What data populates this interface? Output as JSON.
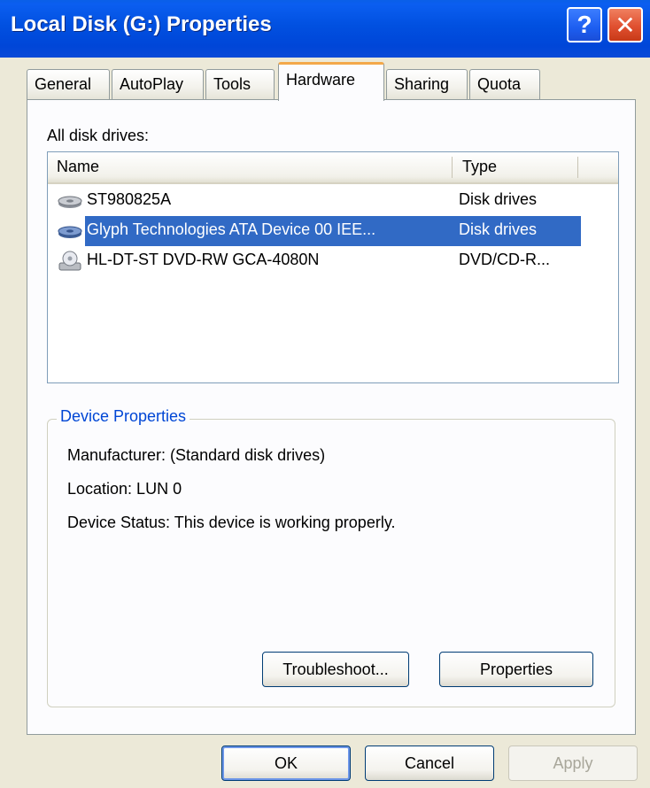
{
  "window": {
    "title": "Local Disk (G:) Properties",
    "help_glyph": "?",
    "close_glyph": "✕"
  },
  "tabs": [
    {
      "label": "General"
    },
    {
      "label": "AutoPlay"
    },
    {
      "label": "Tools"
    },
    {
      "label": "Hardware",
      "active": true
    },
    {
      "label": "Sharing"
    },
    {
      "label": "Quota"
    }
  ],
  "hardware": {
    "list_label": "All disk drives:",
    "columns": {
      "name": "Name",
      "type": "Type"
    },
    "drives": [
      {
        "name": "ST980825A",
        "type": "Disk drives",
        "icon": "hard-disk-icon",
        "selected": false
      },
      {
        "name": "Glyph Technologies ATA Device 00 IEE...",
        "type": "Disk drives",
        "icon": "hard-disk-icon",
        "selected": true
      },
      {
        "name": "HL-DT-ST DVD-RW GCA-4080N",
        "type": "DVD/CD-R...",
        "icon": "dvd-drive-icon",
        "selected": false
      }
    ],
    "device_properties": {
      "legend": "Device Properties",
      "manufacturer": "Manufacturer: (Standard disk drives)",
      "location": "Location: LUN 0",
      "status": "Device Status: This device is working properly."
    },
    "buttons": {
      "troubleshoot": "Troubleshoot...",
      "properties": "Properties"
    }
  },
  "dialog_buttons": {
    "ok": "OK",
    "cancel": "Cancel",
    "apply": "Apply"
  },
  "colors": {
    "titlebar": "#0050e0",
    "selection": "#316ac5",
    "group_legend": "#0046d5",
    "active_tab_accent": "#f3a84a"
  }
}
